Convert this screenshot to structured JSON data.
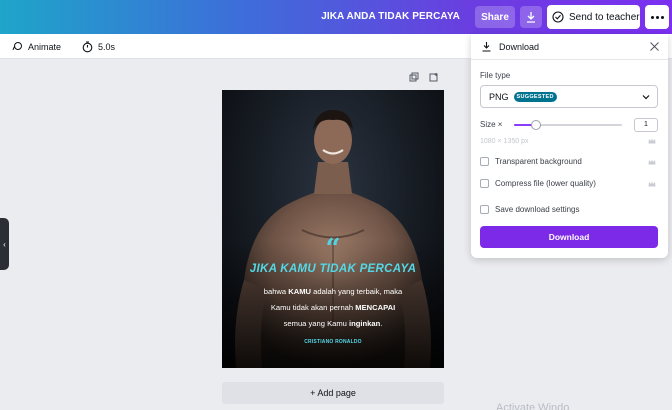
{
  "header": {
    "doc_title": "JIKA ANDA TIDAK PERCAYA",
    "share_label": "Share",
    "send_teacher_label": "Send to teacher"
  },
  "toolbar": {
    "animate_label": "Animate",
    "duration_label": "5.0s"
  },
  "design": {
    "quote_mark": "“",
    "title": "JIKA KAMU TIDAK PERCAYA",
    "body_lines": [
      [
        "bahwa ",
        "KAMU",
        " adalah yang terbaik, maka"
      ],
      [
        "Kamu tidak akan pernah ",
        "MENCAPAI",
        ""
      ],
      [
        "semua yang Kamu ",
        "inginkan",
        "."
      ]
    ],
    "author": "CRISTIANO RONALDO"
  },
  "canvas": {
    "add_page_label": "+ Add page",
    "watermark": "Activate Windo"
  },
  "download_panel": {
    "title": "Download",
    "file_type_label": "File type",
    "file_type_value": "PNG",
    "suggested_badge": "SUGGESTED",
    "size_label": "Size ×",
    "size_value": "1",
    "size_slider_fraction": 0.2,
    "dimensions": "1080 × 1350 px",
    "options": [
      "Transparent background",
      "Compress file (lower quality)",
      "Save download settings"
    ],
    "download_button": "Download"
  },
  "colors": {
    "accent_purple": "#7d2ae8",
    "quote_cyan": "#52d9e8",
    "suggested_teal": "#00738f"
  }
}
